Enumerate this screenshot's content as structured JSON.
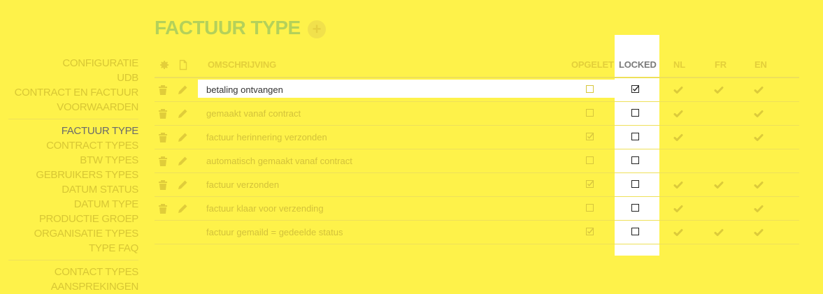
{
  "page": {
    "title": "FACTUUR TYPE"
  },
  "sidebar": {
    "group1": [
      "CONFIGURATIE",
      "UDB",
      "CONTRACT EN FACTUUR",
      "VOORWAARDEN"
    ],
    "group2": [
      "FACTUUR TYPE",
      "CONTRACT TYPES",
      "BTW TYPES",
      "GEBRUIKERS TYPES",
      "DATUM STATUS",
      "DATUM TYPE",
      "PRODUCTIE GROEP",
      "ORGANISATIE TYPES",
      "TYPE FAQ"
    ],
    "group3": [
      "CONTACT TYPES",
      "AANSPREKINGEN"
    ],
    "active": "FACTUUR TYPE"
  },
  "table": {
    "headers": {
      "settings_icon": "gear-icon",
      "doc_icon": "document-icon",
      "omschrijving": "OMSCHRIJVING",
      "opgelet": "OPGELET",
      "locked": "LOCKED",
      "nl": "NL",
      "fr": "FR",
      "en": "EN"
    },
    "rows": [
      {
        "desc": "betaling ontvangen",
        "deletable": true,
        "opgelet": false,
        "locked": true,
        "nl": true,
        "fr": true,
        "en": true
      },
      {
        "desc": "gemaakt vanaf contract",
        "deletable": true,
        "opgelet": false,
        "locked": false,
        "nl": true,
        "fr": false,
        "en": true
      },
      {
        "desc": "factuur herinnering verzonden",
        "deletable": true,
        "opgelet": true,
        "locked": false,
        "nl": true,
        "fr": false,
        "en": true
      },
      {
        "desc": "automatisch gemaakt vanaf contract",
        "deletable": true,
        "opgelet": false,
        "locked": false,
        "nl": false,
        "fr": false,
        "en": false
      },
      {
        "desc": "factuur verzonden",
        "deletable": true,
        "opgelet": true,
        "locked": false,
        "nl": true,
        "fr": true,
        "en": true
      },
      {
        "desc": "factuur klaar voor verzending",
        "deletable": true,
        "opgelet": false,
        "locked": false,
        "nl": true,
        "fr": false,
        "en": true
      },
      {
        "desc": "factuur gemaild = gedeelde status",
        "deletable": false,
        "opgelet": true,
        "locked": false,
        "nl": true,
        "fr": true,
        "en": true
      }
    ]
  },
  "colors": {
    "background": "#fef24a",
    "accent_green": "#b4d15a",
    "muted": "#d8c734"
  }
}
